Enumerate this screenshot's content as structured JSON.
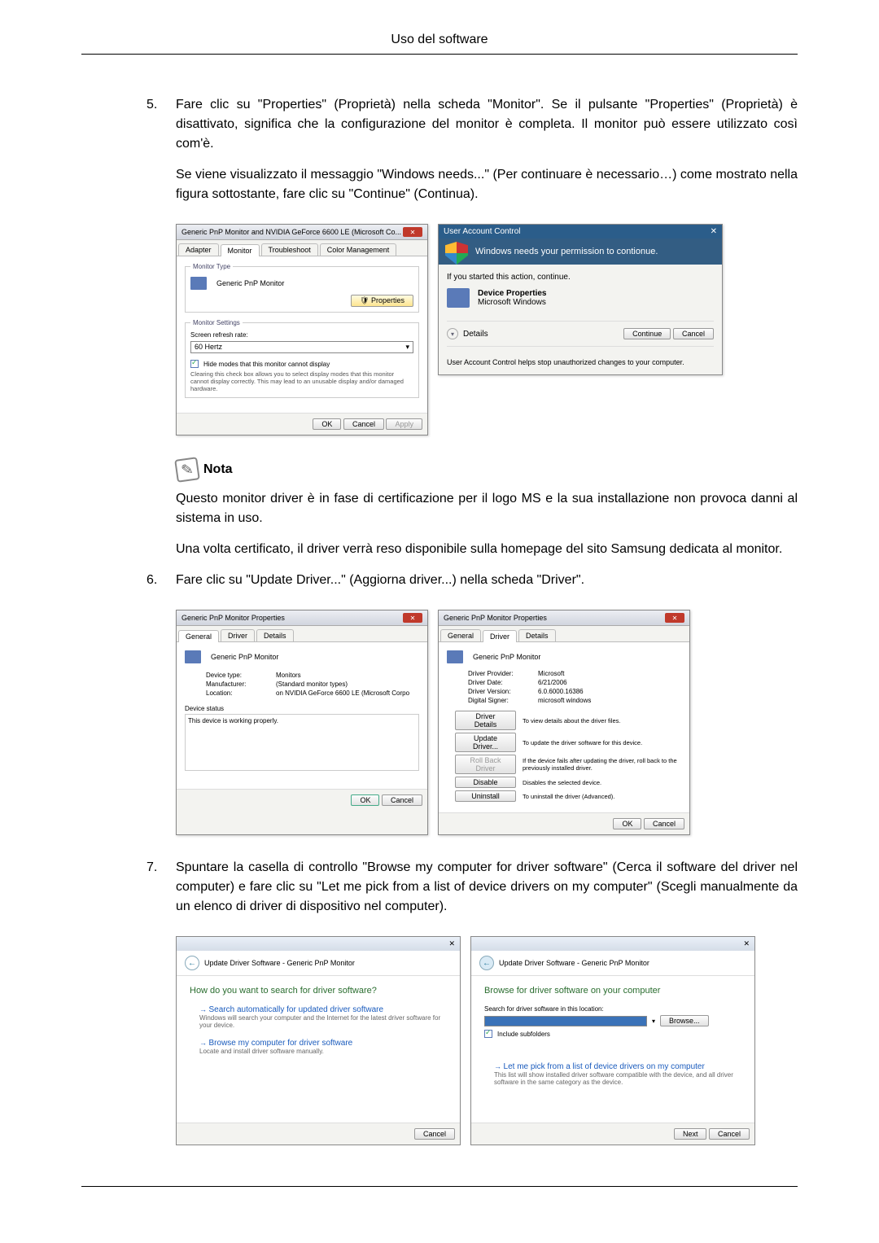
{
  "header": {
    "title": "Uso del software"
  },
  "step5": {
    "num": "5.",
    "p1": "Fare clic su \"Properties\" (Proprietà) nella scheda \"Monitor\". Se il pulsante \"Properties\" (Proprietà) è disattivato, significa che la configurazione del monitor è completa. Il monitor può essere utilizzato così com'è.",
    "p2": "Se viene visualizzato il messaggio \"Windows needs...\" (Per continuare è necessario…) come mostrato nella figura sottostante, fare clic su \"Continue\" (Continua)."
  },
  "monitorDialog": {
    "title": "Generic PnP Monitor and NVIDIA GeForce 6600 LE (Microsoft Co...",
    "tabs": [
      "Adapter",
      "Monitor",
      "Troubleshoot",
      "Color Management"
    ],
    "monitorTypeLabel": "Monitor Type",
    "monitorName": "Generic PnP Monitor",
    "propertiesBtn": "Properties",
    "settingsLabel": "Monitor Settings",
    "refreshLabel": "Screen refresh rate:",
    "refreshValue": "60 Hertz",
    "hideModesLabel": "Hide modes that this monitor cannot display",
    "hideModesDesc": "Clearing this check box allows you to select display modes that this monitor cannot display correctly. This may lead to an unusable display and/or damaged hardware.",
    "ok": "OK",
    "cancel": "Cancel",
    "apply": "Apply"
  },
  "uac": {
    "title": "User Account Control",
    "banner": "Windows needs your permission to contionue.",
    "ifStarted": "If you started this action, continue.",
    "progName": "Device Properties",
    "progVendor": "Microsoft Windows",
    "details": "Details",
    "continue": "Continue",
    "cancel": "Cancel",
    "footer": "User Account Control helps stop unauthorized changes to your computer."
  },
  "note": {
    "label": "Nota",
    "p1": "Questo monitor driver è in fase di certificazione per il logo MS e la sua installazione non provoca danni al sistema in uso.",
    "p2": "Una volta certificato, il driver verrà reso disponibile sulla homepage del sito Samsung dedicata al monitor."
  },
  "step6": {
    "num": "6.",
    "p1": "Fare clic su \"Update Driver...\" (Aggiorna driver...) nella scheda \"Driver\"."
  },
  "propsGeneral": {
    "title": "Generic PnP Monitor Properties",
    "tabs": [
      "General",
      "Driver",
      "Details"
    ],
    "name": "Generic PnP Monitor",
    "deviceTypeL": "Device type:",
    "deviceTypeV": "Monitors",
    "manufL": "Manufacturer:",
    "manufV": "(Standard monitor types)",
    "locL": "Location:",
    "locV": "on NVIDIA GeForce 6600 LE (Microsoft Corpo",
    "statusLabel": "Device status",
    "statusText": "This device is working properly.",
    "ok": "OK",
    "cancel": "Cancel"
  },
  "propsDriver": {
    "title": "Generic PnP Monitor Properties",
    "tabs": [
      "General",
      "Driver",
      "Details"
    ],
    "name": "Generic PnP Monitor",
    "provL": "Driver Provider:",
    "provV": "Microsoft",
    "dateL": "Driver Date:",
    "dateV": "6/21/2006",
    "verL": "Driver Version:",
    "verV": "6.0.6000.16386",
    "signL": "Digital Signer:",
    "signV": "microsoft windows",
    "btnDetails": "Driver Details",
    "descDetails": "To view details about the driver files.",
    "btnUpdate": "Update Driver...",
    "descUpdate": "To update the driver software for this device.",
    "btnRollback": "Roll Back Driver",
    "descRollback": "If the device fails after updating the driver, roll back to the previously installed driver.",
    "btnDisable": "Disable",
    "descDisable": "Disables the selected device.",
    "btnUninstall": "Uninstall",
    "descUninstall": "To uninstall the driver (Advanced).",
    "ok": "OK",
    "cancel": "Cancel"
  },
  "step7": {
    "num": "7.",
    "p1": "Spuntare la casella di controllo \"Browse my computer for driver software\" (Cerca il software del driver nel computer) e fare clic su \"Let me pick from a list of device drivers on my computer\" (Scegli manualmente da un elenco di driver di dispositivo nel computer)."
  },
  "wizard1": {
    "nav": "Update Driver Software - Generic PnP Monitor",
    "q": "How do you want to search for driver software?",
    "opt1": "Search automatically for updated driver software",
    "opt1d": "Windows will search your computer and the Internet for the latest driver software for your device.",
    "opt2": "Browse my computer for driver software",
    "opt2d": "Locate and install driver software manually.",
    "cancel": "Cancel"
  },
  "wizard2": {
    "nav": "Update Driver Software - Generic PnP Monitor",
    "q": "Browse for driver software on your computer",
    "searchLabel": "Search for driver software in this location:",
    "browse": "Browse...",
    "include": "Include subfolders",
    "pick": "Let me pick from a list of device drivers on my computer",
    "pickd": "This list will show installed driver software compatible with the device, and all driver software in the same category as the device.",
    "next": "Next",
    "cancel": "Cancel"
  }
}
